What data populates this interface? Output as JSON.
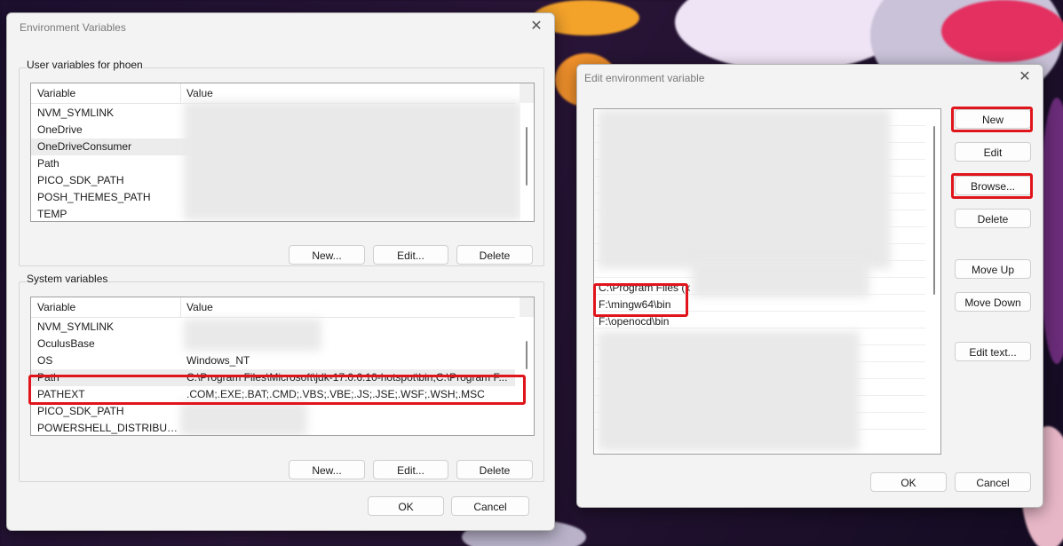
{
  "env_dialog": {
    "title": "Environment Variables",
    "close_glyph": "✕",
    "user_group_label": "User variables for phoen",
    "user_table": {
      "col_variable": "Variable",
      "col_value": "Value",
      "rows": [
        {
          "name": "NVM_SYMLINK",
          "value": ""
        },
        {
          "name": "OneDrive",
          "value": ""
        },
        {
          "name": "OneDriveConsumer",
          "value": ""
        },
        {
          "name": "Path",
          "value": ""
        },
        {
          "name": "PICO_SDK_PATH",
          "value": ""
        },
        {
          "name": "POSH_THEMES_PATH",
          "value": ""
        },
        {
          "name": "TEMP",
          "value": ""
        }
      ]
    },
    "user_buttons": {
      "new": "New...",
      "edit": "Edit...",
      "delete": "Delete"
    },
    "system_group_label": "System variables",
    "system_table": {
      "col_variable": "Variable",
      "col_value": "Value",
      "rows": [
        {
          "name": "NVM_SYMLINK",
          "value": ""
        },
        {
          "name": "OculusBase",
          "value": ""
        },
        {
          "name": "OS",
          "value": "Windows_NT"
        },
        {
          "name": "Path",
          "value": "C:\\Program Files\\Microsoft\\jdk-17.0.6.10-hotspot\\bin;C:\\Program F..."
        },
        {
          "name": "PATHEXT",
          "value": ".COM;.EXE;.BAT;.CMD;.VBS;.VBE;.JS;.JSE;.WSF;.WSH;.MSC"
        },
        {
          "name": "PICO_SDK_PATH",
          "value": ""
        },
        {
          "name": "POWERSHELL_DISTRIBUTIO...",
          "value": ""
        }
      ]
    },
    "system_buttons": {
      "new": "New...",
      "edit": "Edit...",
      "delete": "Delete"
    },
    "ok": "OK",
    "cancel": "Cancel"
  },
  "edit_dialog": {
    "title": "Edit environment variable",
    "close_glyph": "✕",
    "path_items": [
      {
        "text": "C:\\Program Files (x"
      },
      {
        "text": "F:\\mingw64\\bin"
      },
      {
        "text": "F:\\openocd\\bin"
      }
    ],
    "buttons": {
      "new": "New",
      "edit": "Edit",
      "browse": "Browse...",
      "delete": "Delete",
      "move_up": "Move Up",
      "move_down": "Move Down",
      "edit_text": "Edit text..."
    },
    "ok": "OK",
    "cancel": "Cancel"
  },
  "colors": {
    "highlight_red": "#e0141b",
    "dialog_bg": "#f3f3f3"
  }
}
